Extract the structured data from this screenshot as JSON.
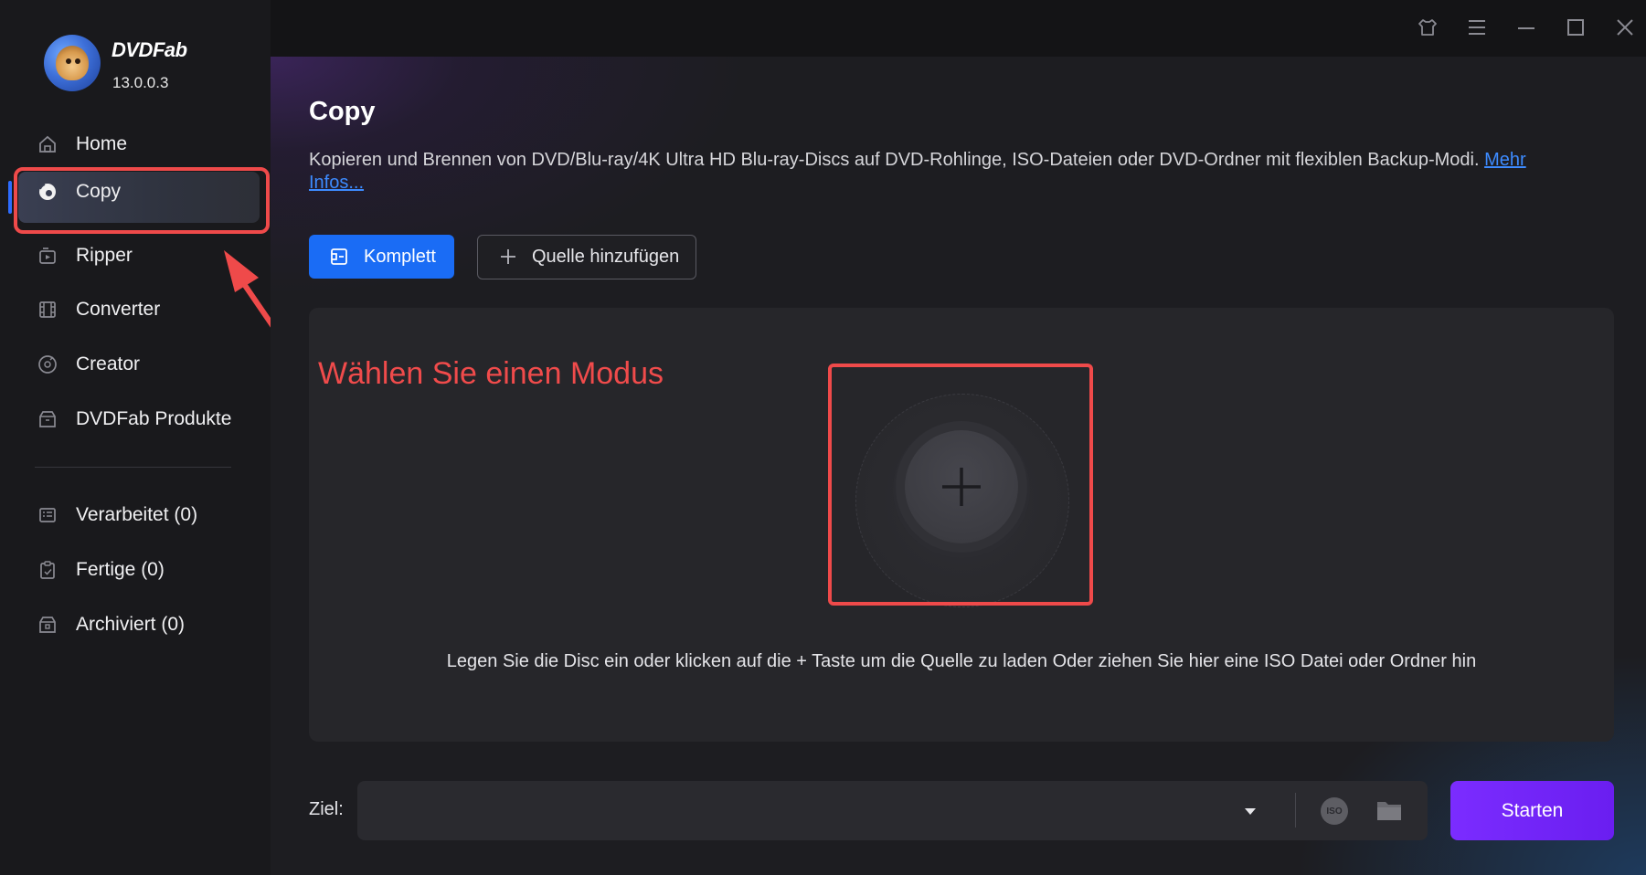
{
  "app": {
    "brand": "DVDFab",
    "version": "13.0.0.3"
  },
  "sidebar": {
    "items": [
      {
        "label": "Home",
        "icon": "home-icon"
      },
      {
        "label": "Copy",
        "icon": "disc-icon",
        "active": true
      },
      {
        "label": "Ripper",
        "icon": "ripper-icon"
      },
      {
        "label": "Converter",
        "icon": "film-icon"
      },
      {
        "label": "Creator",
        "icon": "creator-disc-icon"
      },
      {
        "label": "DVDFab Produkte",
        "icon": "products-box-icon"
      }
    ],
    "queue": [
      {
        "label": "Verarbeitet (0)",
        "icon": "list-icon"
      },
      {
        "label": "Fertige (0)",
        "icon": "clipboard-check-icon"
      },
      {
        "label": "Archiviert (0)",
        "icon": "archive-icon"
      }
    ]
  },
  "main": {
    "title": "Copy",
    "description": "Kopieren und Brennen von DVD/Blu-ray/4K Ultra HD Blu-ray-Discs auf DVD-Rohlinge, ISO-Dateien oder DVD-Ordner mit flexiblen Backup-Modi.",
    "more_link": "Mehr Infos...",
    "mode_button": "Komplett",
    "add_source_button": "Quelle hinzufügen",
    "annotation": "Wählen Sie einen Modus",
    "drop_hint": "Legen Sie die Disc ein oder klicken auf die + Taste um die Quelle zu laden Oder ziehen Sie hier eine ISO Datei oder Ordner hin",
    "target_label": "Ziel:",
    "target_value": "",
    "iso_label": "ISO",
    "start_button": "Starten"
  },
  "colors": {
    "accent_blue": "#1a6cf5",
    "start_purple": "#7b2cff",
    "annotation_red": "#ef4a4a"
  }
}
